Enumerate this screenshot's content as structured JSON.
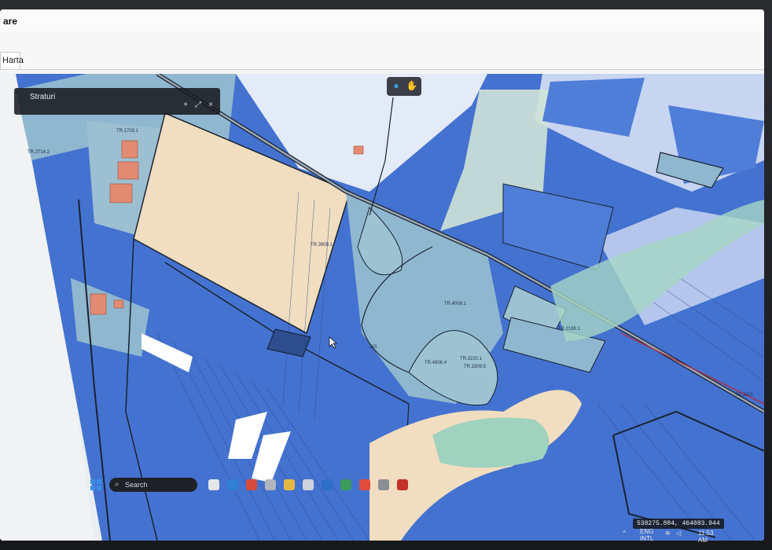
{
  "window": {
    "title": "are",
    "active_tab": "Harta"
  },
  "layer_panel": {
    "title": "Straturi",
    "buttons": [
      "+",
      "⤢",
      "×"
    ]
  },
  "toolbar": {
    "tools": [
      {
        "icon": "globe-icon",
        "glyph": "●"
      },
      {
        "icon": "hand-icon",
        "glyph": "✋"
      }
    ]
  },
  "map": {
    "parcel_labels": [
      "TR.1703.1",
      "TR.3714.2",
      "TR.3909.1",
      "TR.4009.1",
      "TR.3220.1",
      "TR.4806.4",
      "TR.3309.5",
      "TR.2189.1",
      "TR.2501",
      "115"
    ],
    "cursor_visible": true
  },
  "status": {
    "coordinates": "538275.884, 464083.944"
  },
  "taskbar": {
    "search_placeholder": "Search",
    "language_top": "ENG",
    "language_bottom": "INTL",
    "clock": "11:53 AM"
  },
  "colors": {
    "parcel_blue": "#4472d0",
    "parcel_light": "#8fb7cf",
    "parcel_sand": "#f1ddbf",
    "river": "#9fd2bf",
    "boundary": "#1a2330"
  }
}
